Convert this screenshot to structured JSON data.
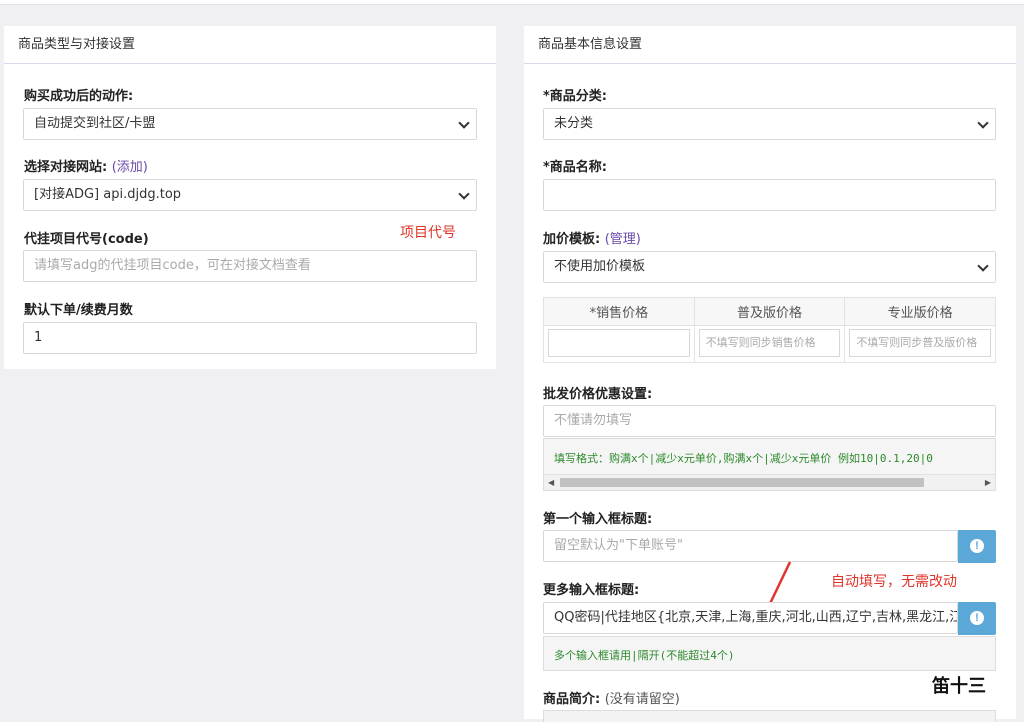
{
  "left_panel": {
    "title": "商品类型与对接设置",
    "action_label": "购买成功后的动作:",
    "action_value": "自动提交到社区/卡盟",
    "site_label": "选择对接网站:",
    "site_add": "(添加)",
    "site_value": "[对接ADG] api.djdg.top",
    "code_label": "代挂项目代号(code)",
    "code_note": "项目代号",
    "code_placeholder": "请填写adg的代挂项目code，可在对接文档查看",
    "months_label": "默认下单/续费月数",
    "months_value": "1"
  },
  "right_panel": {
    "title": "商品基本信息设置",
    "category_label": "*商品分类:",
    "category_value": "未分类",
    "name_label": "*商品名称:",
    "name_value": "",
    "markup_label": "加价模板:",
    "markup_manage": "(管理)",
    "markup_value": "不使用加价模板",
    "price_headers": [
      "*销售价格",
      "普及版价格",
      "专业版价格"
    ],
    "price_placeholders": [
      "",
      "不填写则同步销售价格",
      "不填写则同步普及版价格"
    ],
    "wholesale_label": "批发价格优惠设置:",
    "wholesale_placeholder": "不懂请勿填写",
    "wholesale_hint": "填写格式：购满x个|减少x元单价,购满x个|减少x元单价  例如10|0.1,20|0",
    "first_input_label": "第一个输入框标题:",
    "first_input_placeholder": "留空默认为\"下单账号\"",
    "more_input_label": "更多输入框标题:",
    "more_input_value": "QQ密码|代挂地区{北京,天津,上海,重庆,河北,山西,辽宁,吉林,黑龙江,江",
    "more_input_hint": "多个输入框请用|隔开(不能超过4个)",
    "auto_note": "自动填写，无需改动",
    "intro_label": "商品简介:",
    "intro_sub": "(没有请留空)"
  },
  "watermark": "笛十三",
  "colors": {
    "note_red": "#e0332a",
    "info_button": "#5aa7d8",
    "hint_green": "#2c8a2c",
    "link_purple": "#6a4aa8"
  }
}
